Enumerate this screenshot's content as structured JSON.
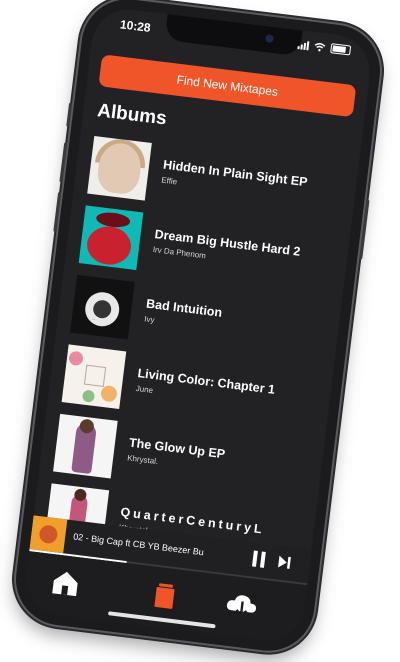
{
  "status_bar": {
    "time": "10:28"
  },
  "header": {
    "cta_label": "Find New Mixtapes",
    "section_title": "Albums"
  },
  "albums": [
    {
      "title": "Hidden In Plain Sight EP",
      "artist": "Effie",
      "art_icon": "album-art-portrait"
    },
    {
      "title": "Dream Big Hustle Hard 2",
      "artist": "Irv Da Phenom",
      "art_icon": "album-art-red-figure"
    },
    {
      "title": "Bad Intuition",
      "artist": "Ivy",
      "art_icon": "album-art-dark"
    },
    {
      "title": "Living Color: Chapter 1",
      "artist": "June",
      "art_icon": "album-art-floral"
    },
    {
      "title": "The Glow Up EP",
      "artist": "Khrystal.",
      "art_icon": "album-art-figure"
    },
    {
      "title": "QuarterCenturyL",
      "artist": "Khrystal.",
      "art_icon": "album-art-figure"
    }
  ],
  "player": {
    "now_playing": "02 - Big Cap ft CB YB Beezer Bu",
    "progress": 0.35
  },
  "tabbar": {
    "items": [
      "home-icon",
      "library-icon",
      "download-cloud-icon"
    ]
  },
  "colors": {
    "accent": "#f0552a",
    "background": "#222225",
    "tabbar": "#1d1d20"
  }
}
